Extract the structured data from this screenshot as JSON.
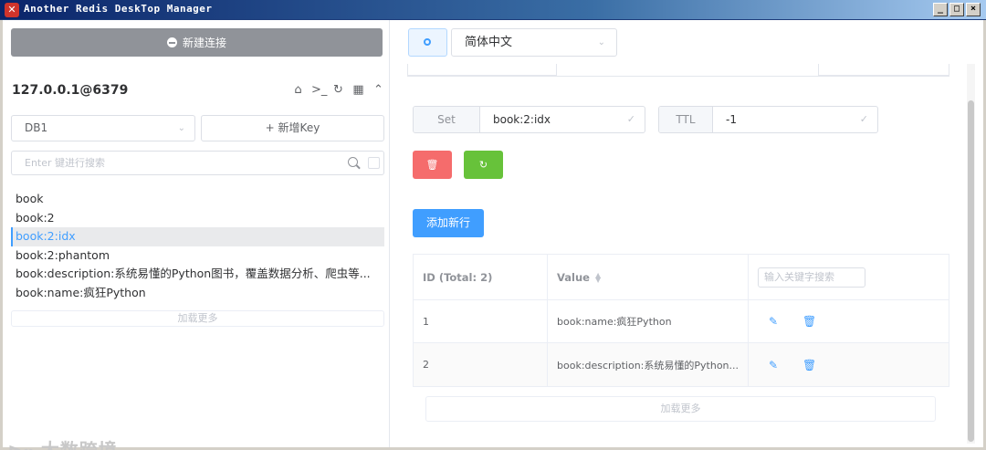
{
  "window": {
    "title": "Another Redis DeskTop Manager",
    "app_icon": "redis-logo-icon",
    "controls": [
      "_",
      "□",
      "×"
    ]
  },
  "sidebar": {
    "new_connection_label": "新建连接",
    "connection_name": "127.0.0.1@6379",
    "tools": {
      "home": "⌂",
      "console": ">_",
      "refresh": "↻",
      "grid": "▦",
      "collapse": "⌃"
    },
    "db_selected": "DB1",
    "new_key_label": "+ 新增Key",
    "search_placeholder": "Enter 键进行搜索",
    "keys": [
      "book",
      "book:2",
      "book:2:idx",
      "book:2:phantom",
      "book:description:系统易懂的Python图书，覆盖数据分析、爬虫等...",
      "book:name:疯狂Python"
    ],
    "active_key_index": 2,
    "load_more": "加载更多"
  },
  "settings": {
    "language": "简体中文"
  },
  "key_detail": {
    "type_label": "Set",
    "key_name": "book:2:idx",
    "ttl_label": "TTL",
    "ttl_value": "-1",
    "delete_icon": "trash-icon",
    "refresh_icon": "refresh-icon",
    "add_row_label": "添加新行",
    "table": {
      "col_id": "ID (Total: 2)",
      "col_value": "Value",
      "search_placeholder": "输入关键字搜索",
      "rows": [
        {
          "id": "1",
          "value": "book:name:疯狂Python"
        },
        {
          "id": "2",
          "value": "book:description:系统易懂的Python..."
        }
      ]
    },
    "load_more": "加载更多"
  },
  "watermark": "大数跨境",
  "colors": {
    "primary": "#409eff",
    "danger": "#f56c6c",
    "success": "#67c23a",
    "info": "#909399"
  }
}
